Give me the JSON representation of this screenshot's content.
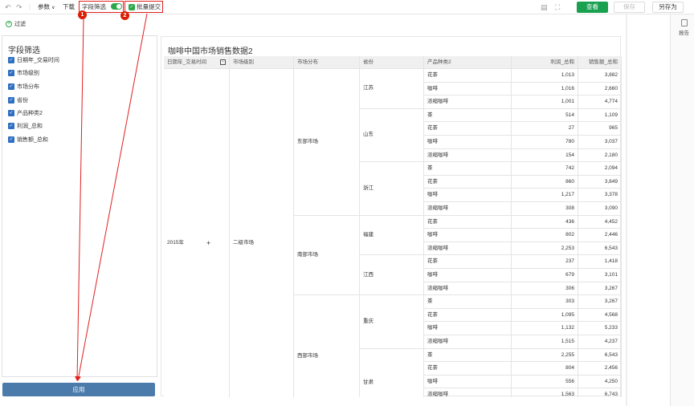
{
  "toolbar": {
    "undo_icon": "undo-icon",
    "redo_icon": "redo-icon",
    "params_label": "参数",
    "download_label": "下载",
    "field_filter_label": "字段筛选",
    "batch_submit_label": "批量提交",
    "view_label": "查看",
    "save_label": "保存",
    "save_as_label": "另存为"
  },
  "annotations": {
    "badge1": "1",
    "badge2": "2",
    "color": "#e02020"
  },
  "filter": {
    "label": "过滤"
  },
  "left_panel": {
    "title": "字段筛选",
    "items": [
      {
        "label": "日期年_交易时间"
      },
      {
        "label": "市场级别"
      },
      {
        "label": "市场分布"
      },
      {
        "label": "省份"
      },
      {
        "label": "产品种类2"
      },
      {
        "label": "利润_总和"
      },
      {
        "label": "销售额_总和"
      }
    ],
    "apply_label": "应用"
  },
  "side": {
    "report_label": "报告"
  },
  "table": {
    "title": "咖啡中国市场销售数据2",
    "headers": [
      "日期年_交易时间",
      "市场级别",
      "市场分布",
      "省份",
      "产品种类2",
      "利润_总和",
      "销售额_总和"
    ],
    "year": "2015年",
    "year_expand": "+",
    "level": "二级市场",
    "markets": [
      {
        "name": "东部市场"
      },
      {
        "name": "南部市场"
      },
      {
        "name": "西部市场"
      }
    ],
    "provinces": [
      {
        "name": "江苏"
      },
      {
        "name": "山东"
      },
      {
        "name": "浙江"
      },
      {
        "name": "福建"
      },
      {
        "name": "江西"
      },
      {
        "name": "重庆"
      },
      {
        "name": "甘肃"
      }
    ],
    "rows": [
      {
        "p": "花茶",
        "profit": "1,013",
        "sales": "3,882"
      },
      {
        "p": "咖啡",
        "profit": "1,016",
        "sales": "2,660"
      },
      {
        "p": "浓缩咖啡",
        "profit": "1,001",
        "sales": "4,774"
      },
      {
        "p": "茶",
        "profit": "514",
        "sales": "1,109"
      },
      {
        "p": "花茶",
        "profit": "27",
        "sales": "965"
      },
      {
        "p": "咖啡",
        "profit": "780",
        "sales": "3,037"
      },
      {
        "p": "浓缩咖啡",
        "profit": "154",
        "sales": "2,180"
      },
      {
        "p": "茶",
        "profit": "742",
        "sales": "2,094"
      },
      {
        "p": "花茶",
        "profit": "860",
        "sales": "3,849"
      },
      {
        "p": "咖啡",
        "profit": "1,217",
        "sales": "3,378"
      },
      {
        "p": "浓缩咖啡",
        "profit": "308",
        "sales": "3,090"
      },
      {
        "p": "花茶",
        "profit": "436",
        "sales": "4,452"
      },
      {
        "p": "咖啡",
        "profit": "802",
        "sales": "2,446"
      },
      {
        "p": "浓缩咖啡",
        "profit": "2,253",
        "sales": "6,543"
      },
      {
        "p": "花茶",
        "profit": "237",
        "sales": "1,418"
      },
      {
        "p": "咖啡",
        "profit": "679",
        "sales": "3,101"
      },
      {
        "p": "浓缩咖啡",
        "profit": "306",
        "sales": "3,267"
      },
      {
        "p": "茶",
        "profit": "303",
        "sales": "3,267"
      },
      {
        "p": "花茶",
        "profit": "1,095",
        "sales": "4,568"
      },
      {
        "p": "咖啡",
        "profit": "1,132",
        "sales": "5,233"
      },
      {
        "p": "浓缩咖啡",
        "profit": "1,515",
        "sales": "4,237"
      },
      {
        "p": "茶",
        "profit": "2,255",
        "sales": "6,543"
      },
      {
        "p": "花茶",
        "profit": "804",
        "sales": "2,456"
      },
      {
        "p": "咖啡",
        "profit": "556",
        "sales": "4,250"
      },
      {
        "p": "浓缩咖啡",
        "profit": "1,563",
        "sales": "6,743"
      }
    ]
  }
}
